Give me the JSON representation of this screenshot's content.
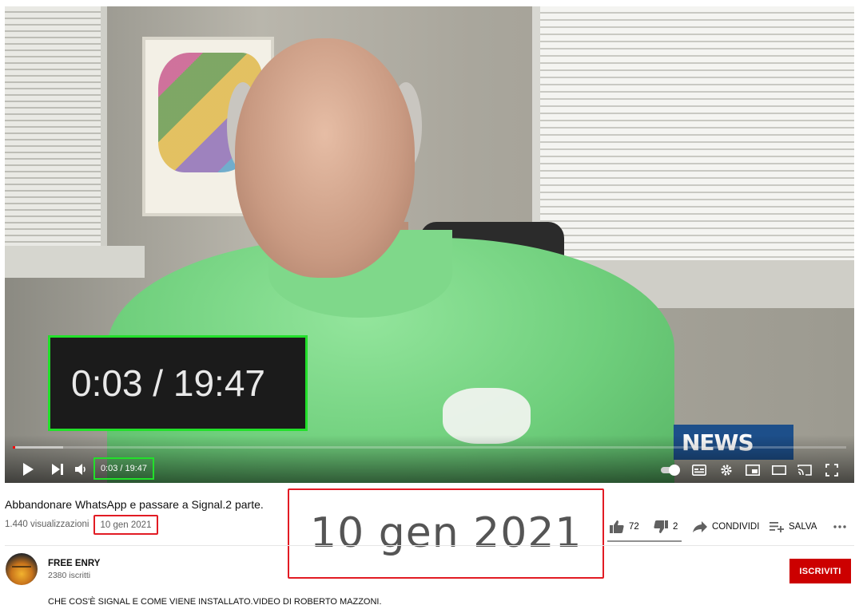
{
  "video": {
    "current_time_label": "0:03 / 19:47",
    "zoom_time_label": "0:03 / 19:47",
    "progress_played_fraction": 0.003,
    "progress_buffered_fraction": 0.06,
    "overlay_logo_text": "NEWS"
  },
  "controls": {
    "play_icon": "play-icon",
    "next_icon": "next-icon",
    "volume_icon": "volume-icon",
    "autoplay_icon": "autoplay-toggle",
    "subtitles_icon": "subtitles-icon",
    "settings_icon": "gear-icon",
    "miniplayer_icon": "miniplayer-icon",
    "theater_icon": "theater-icon",
    "cast_icon": "cast-icon",
    "fullscreen_icon": "fullscreen-icon"
  },
  "info": {
    "title": "Abbandonare WhatsApp e passare a Signal.2 parte.",
    "views": "1.440 visualizzazioni",
    "date": "10 gen 2021",
    "date_zoom": "10 gen 2021",
    "likes": "72",
    "dislikes": "2",
    "share_label": "CONDIVIDI",
    "save_label": "SALVA"
  },
  "channel": {
    "name": "FREE ENRY",
    "subscribers": "2380 iscritti",
    "subscribe_label": "ISCRIVITI",
    "description": "CHE COS'È SIGNAL E COME VIENE INSTALLATO.VIDEO DI ROBERTO MAZZONI."
  },
  "colors": {
    "accent_red": "#cc0000",
    "highlight_green": "#22e02a",
    "highlight_red": "#e21b24"
  }
}
